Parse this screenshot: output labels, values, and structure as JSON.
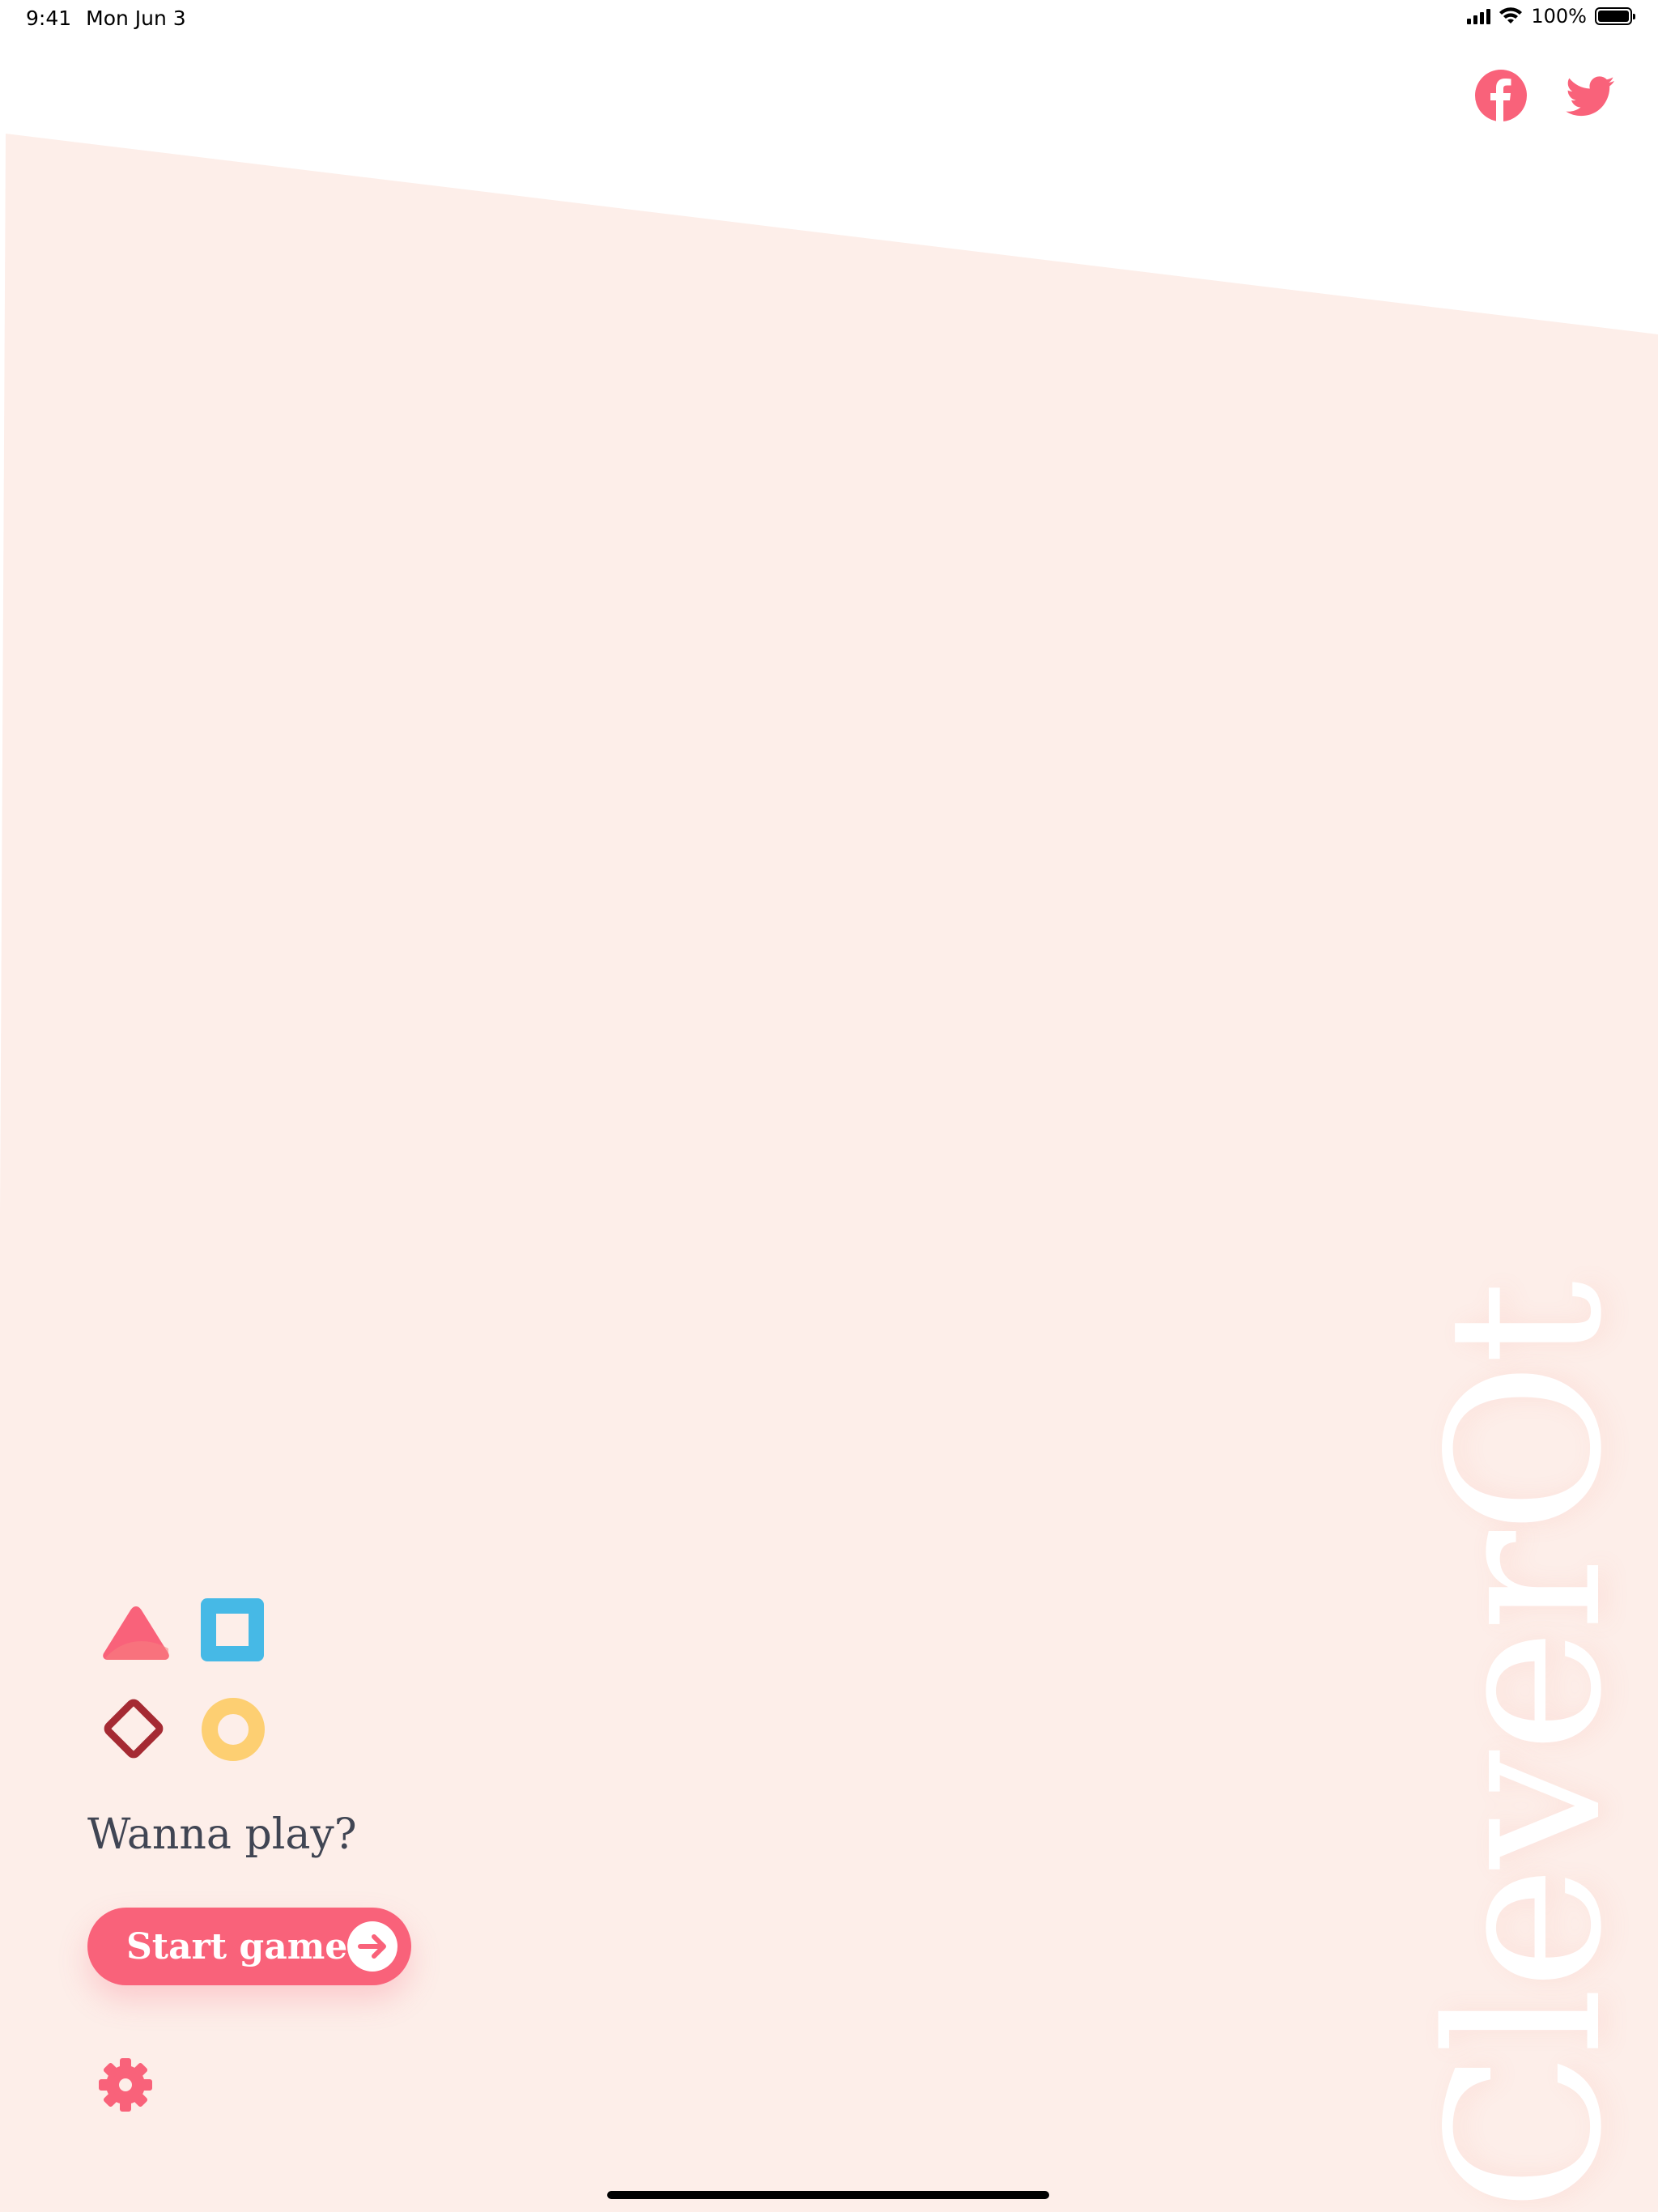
{
  "status_bar": {
    "time": "9:41",
    "date": "Mon Jun 3",
    "battery": "100%",
    "signal_icon": "cellular-signal-icon",
    "wifi_icon": "wifi-icon",
    "battery_icon": "battery-icon"
  },
  "social": {
    "facebook_icon": "facebook-icon",
    "twitter_icon": "twitter-icon"
  },
  "brand": {
    "title": "CleverOt"
  },
  "shapes": [
    "triangle-icon",
    "square-icon",
    "diamond-icon",
    "circle-icon"
  ],
  "main": {
    "tagline": "Wanna play?",
    "start_label": "Start game",
    "start_icon": "arrow-right-circle-icon",
    "settings_icon": "gear-icon"
  },
  "colors": {
    "accent": "#f9627a",
    "background_panel": "#fdeee9",
    "triangle": "#f9627a",
    "square": "#46b9e6",
    "diamond": "#a52a33",
    "circle": "#fdcf72",
    "text_dark": "#404553"
  }
}
